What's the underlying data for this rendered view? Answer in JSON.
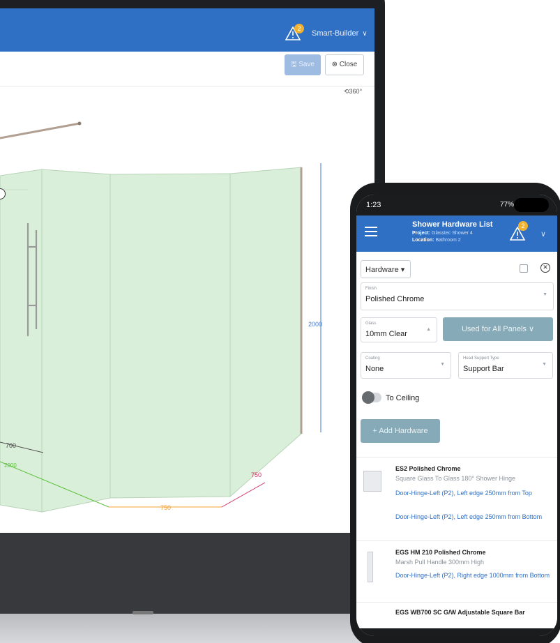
{
  "laptop": {
    "topbar": {
      "warning_count": "2",
      "user_menu": "Smart-Builder",
      "user_chevron": "∨"
    },
    "toolbar": {
      "save_label": "Save",
      "close_label": "Close",
      "rotate_label": "360°"
    },
    "model": {
      "dimensions": {
        "height": "2000",
        "left_width": "700",
        "left_length": "2000",
        "front_width": "750",
        "right_width": "750"
      },
      "colors": {
        "glass": "#d9efd9",
        "glass_edge": "#b8d3b8",
        "frame": "#b19f92",
        "dim_blue": "#3c7bd9",
        "dim_green": "#5cbf3a",
        "dim_orange": "#f0a030",
        "dim_red": "#d03060"
      }
    }
  },
  "phone": {
    "status": {
      "time": "1:23",
      "battery": "77%"
    },
    "header": {
      "title": "Shower Hardware List",
      "project_label": "Project:",
      "project_value": "Glasstec Shower 4",
      "location_label": "Location:",
      "location_value": "Bathroom 2",
      "warning_count": "2"
    },
    "hardware_select": "Hardware",
    "fields": {
      "finish": {
        "label": "Finish",
        "value": "Polished Chrome"
      },
      "glass": {
        "label": "Glass",
        "value": "10mm Clear"
      },
      "used_for": "Used for All Panels",
      "coating": {
        "label": "Coating",
        "value": "None"
      },
      "head_support": {
        "label": "Head Support Type",
        "value": "Support Bar"
      }
    },
    "to_ceiling": "To Ceiling",
    "add_hardware": "+ Add Hardware",
    "items": [
      {
        "name": "ES2 Polished Chrome",
        "desc": "Square Glass To Glass 180° Shower Hinge",
        "links": [
          "Door-Hinge-Left (P2), Left edge 250mm from Top",
          "Door-Hinge-Left (P2), Left edge 250mm from Bottom"
        ]
      },
      {
        "name": "EGS HM 210 Polished Chrome",
        "desc": "Marsh Pull Handle 300mm High",
        "links": [
          "Door-Hinge-Left (P2), Right edge 1000mm from Bottom"
        ]
      },
      {
        "name": "EGS WB700 SC G/W Adjustable Square Bar",
        "desc": "",
        "links": []
      }
    ]
  }
}
